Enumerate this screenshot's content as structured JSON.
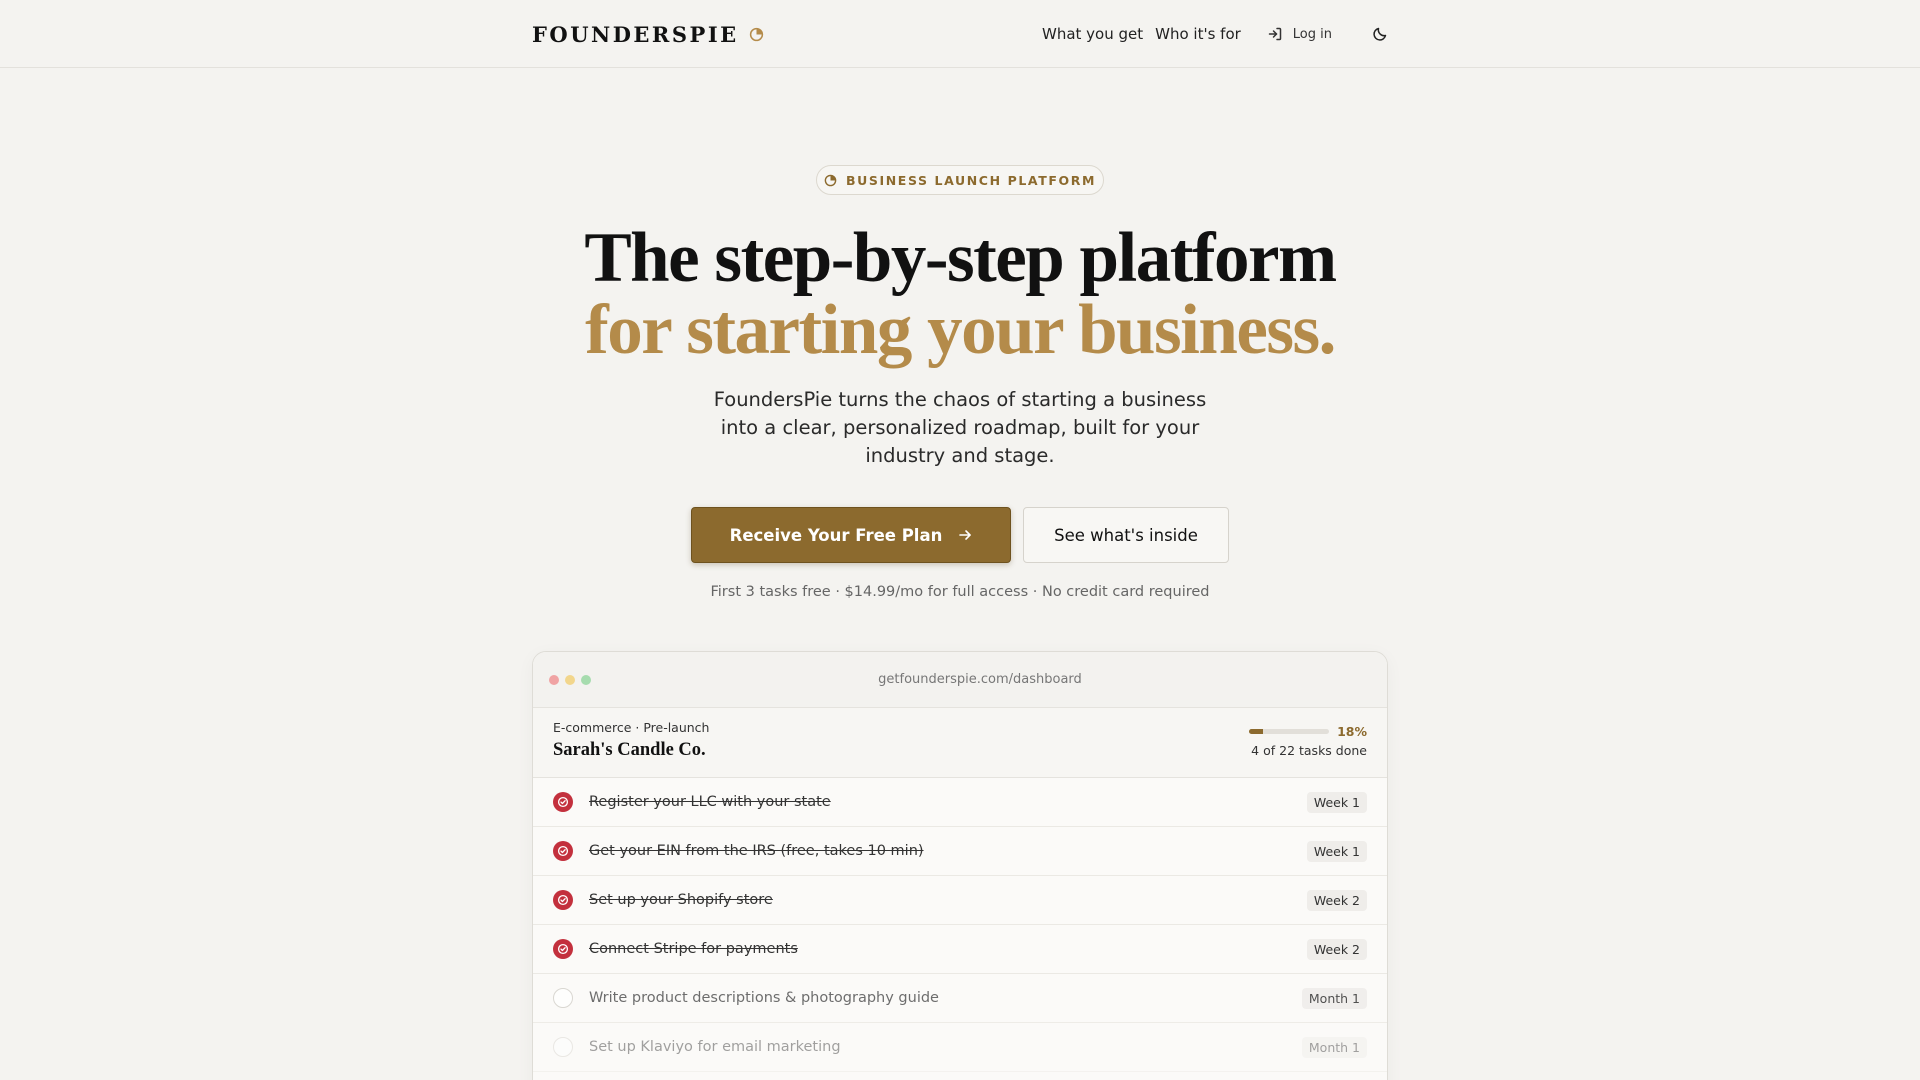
{
  "header": {
    "brand": "FOUNDERSPIE",
    "nav": [
      "What you get",
      "Who it's for"
    ],
    "login": "Log in"
  },
  "hero": {
    "badge": "BUSINESS LAUNCH PLATFORM",
    "headline_line1": "The step-by-step platform",
    "headline_line2": "for starting your business.",
    "subtitle": "FoundersPie turns the chaos of starting a business into a clear, personalized roadmap, built for your industry and stage.",
    "cta_primary": "Receive Your Free Plan",
    "cta_secondary": "See what's inside",
    "fineprint": "First 3 tasks free · $14.99/mo for full access · No credit card required"
  },
  "dashboard": {
    "url": "getfounderspie.com/dashboard",
    "meta": "E-commerce · Pre-launch",
    "company": "Sarah's Candle Co.",
    "progress_pct": "18%",
    "progress_value": 0.18,
    "tasks_done": "4 of 22 tasks done",
    "tasks": [
      {
        "label": "Register your LLC with your state",
        "when": "Week 1",
        "done": true
      },
      {
        "label": "Get your EIN from the IRS (free, takes 10 min)",
        "when": "Week 1",
        "done": true
      },
      {
        "label": "Set up your Shopify store",
        "when": "Week 2",
        "done": true
      },
      {
        "label": "Connect Stripe for payments",
        "when": "Week 2",
        "done": true
      },
      {
        "label": "Write product descriptions & photography guide",
        "when": "Month 1",
        "done": false
      },
      {
        "label": "Set up Klaviyo for email marketing",
        "when": "Month 1",
        "done": false
      }
    ]
  },
  "colors": {
    "accent": "#8c6a2e",
    "accent_light": "#b48b4a",
    "check": "#c3303d",
    "background": "#f4f3f0"
  }
}
